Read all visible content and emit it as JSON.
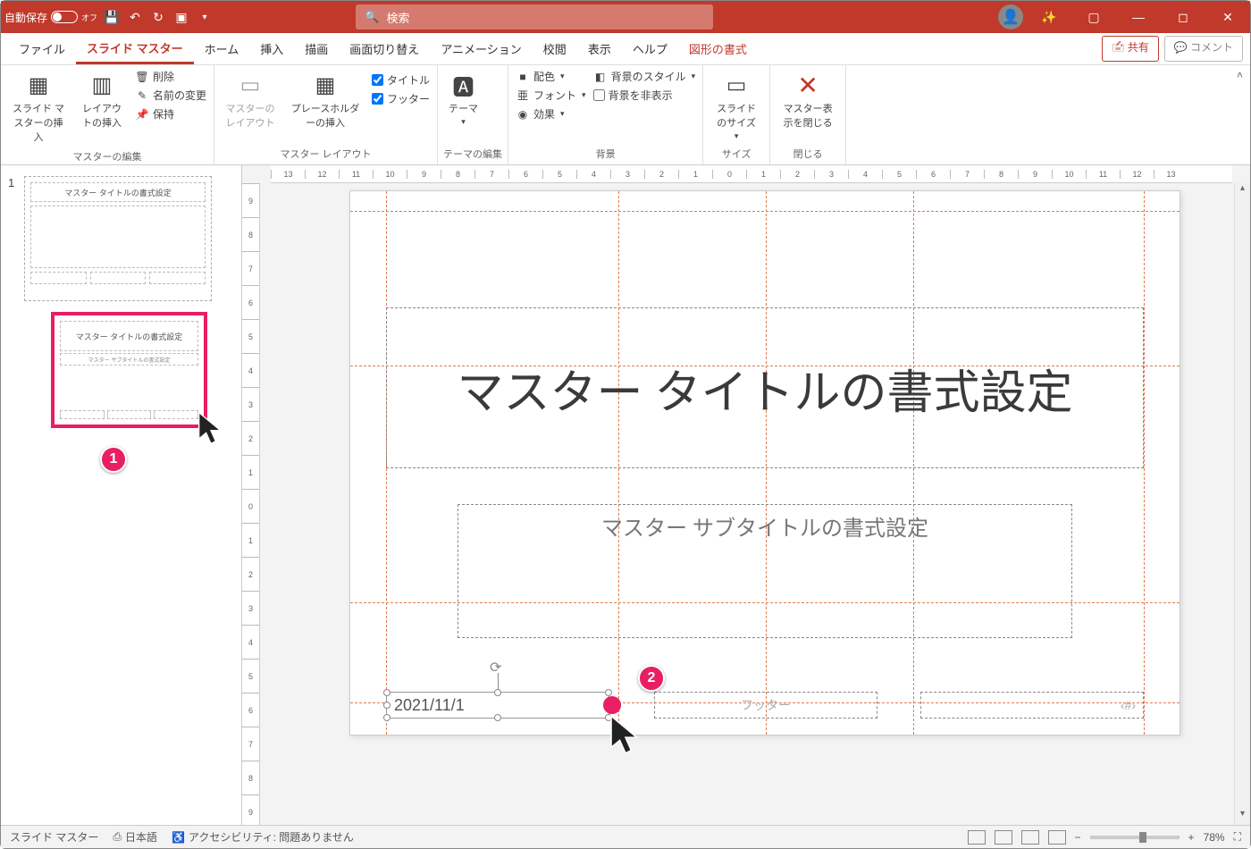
{
  "titlebar": {
    "autosave_label": "自動保存",
    "autosave_state": "オフ",
    "search_placeholder": "検索"
  },
  "tabs": {
    "file": "ファイル",
    "slide_master": "スライド マスター",
    "home": "ホーム",
    "insert": "挿入",
    "draw": "描画",
    "transitions": "画面切り替え",
    "animations": "アニメーション",
    "review": "校閲",
    "view": "表示",
    "help": "ヘルプ",
    "shape_format": "図形の書式",
    "share": "共有",
    "comments": "コメント"
  },
  "ribbon": {
    "edit_master": {
      "insert_slide_master": "スライド マスターの挿入",
      "insert_layout": "レイアウトの挿入",
      "delete": "削除",
      "rename": "名前の変更",
      "preserve": "保持",
      "group_label": "マスターの編集"
    },
    "master_layout": {
      "master_layout": "マスターのレイアウト",
      "insert_placeholder": "プレースホルダーの挿入",
      "chk_title": "タイトル",
      "chk_footer": "フッター",
      "group_label": "マスター レイアウト"
    },
    "edit_theme": {
      "theme": "テーマ",
      "group_label": "テーマの編集"
    },
    "background": {
      "colors": "配色",
      "fonts": "フォント",
      "effects": "効果",
      "bg_styles": "背景のスタイル",
      "hide_bg": "背景を非表示",
      "group_label": "背景"
    },
    "size": {
      "slide_size": "スライドのサイズ",
      "group_label": "サイズ"
    },
    "close": {
      "close_master": "マスター表示を閉じる",
      "group_label": "閉じる"
    }
  },
  "thumbs": {
    "master_title": "マスター タイトルの書式設定",
    "layout_title": "マスター タイトルの書式設定",
    "layout_sub": "マスター サブタイトルの書式設定",
    "number": "1"
  },
  "canvas": {
    "title": "マスター タイトルの書式設定",
    "subtitle": "マスター サブタイトルの書式設定",
    "date": "2021/11/1",
    "footer": "フッター",
    "pagenum": "‹#›"
  },
  "callouts": {
    "one": "1",
    "two": "2"
  },
  "ruler_h": [
    "13",
    "12",
    "11",
    "10",
    "9",
    "8",
    "7",
    "6",
    "5",
    "4",
    "3",
    "2",
    "1",
    "0",
    "1",
    "2",
    "3",
    "4",
    "5",
    "6",
    "7",
    "8",
    "9",
    "10",
    "11",
    "12",
    "13"
  ],
  "ruler_v": [
    "9",
    "8",
    "7",
    "6",
    "5",
    "4",
    "3",
    "2",
    "1",
    "0",
    "1",
    "2",
    "3",
    "4",
    "5",
    "6",
    "7",
    "8",
    "9"
  ],
  "statusbar": {
    "mode": "スライド マスター",
    "lang": "日本語",
    "accessibility": "アクセシビリティ: 問題ありません",
    "zoom": "78%"
  }
}
